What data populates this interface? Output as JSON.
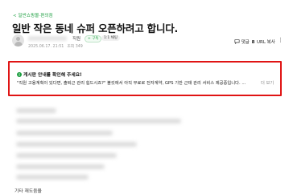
{
  "breadcrumb": "< 일반쇼핑몰·편의점",
  "post": {
    "title": "일반 작은 동네 슈퍼 오픈하려고 합니다.",
    "rank": "직원",
    "subscribe_label": "+ 구독",
    "chat_label": "1:1 채팅",
    "date": "2025.06.17. 21:51",
    "views": "조회 349"
  },
  "actions": {
    "comment_label": "댓글",
    "comment_count": "8",
    "share_label": "URL 복사",
    "more_label": "⋮"
  },
  "notice": {
    "title": "게시판 안내를 확인해 주세요!",
    "body": "\"직원 고용계획이 있다면, 출퇴근 관리 힘드시죠?\" 볼킷에서 아직 무료로 전자계약, GPS 기반 근태 관리 서비스 제공중입니다. ...",
    "more_label": "더 보기"
  },
  "footer_text": "기타 재도움을",
  "colors": {
    "accent_green": "#1a9e3f",
    "highlight_red": "#e01414"
  }
}
